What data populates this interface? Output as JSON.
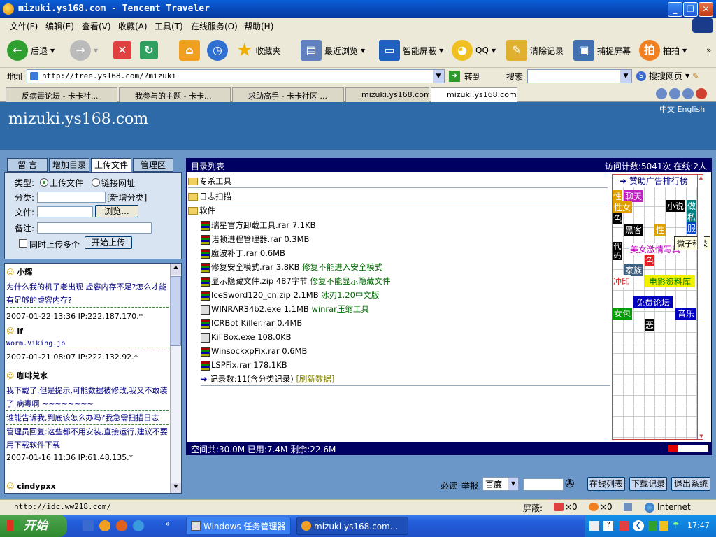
{
  "window": {
    "title": "mizuki.ys168.com - Tencent Traveler"
  },
  "menu": [
    "文件(F)",
    "编辑(E)",
    "查看(V)",
    "收藏(A)",
    "工具(T)",
    "在线服务(O)",
    "帮助(H)"
  ],
  "toolbar": {
    "back": "后退",
    "favorites": "收藏夹",
    "recent": "最近浏览",
    "smart_block": "智能屏蔽",
    "qq": "QQ",
    "clear": "清除记录",
    "capture": "捕捉屏幕",
    "paipai": "拍拍",
    "more": "»"
  },
  "address": {
    "label": "地址",
    "url": "http://free.ys168.com/?mizuki",
    "go": "转到",
    "search_label": "搜索",
    "search_engine": "搜搜网页"
  },
  "tabs": [
    {
      "label": "反病毒论坛 - 卡卡社..."
    },
    {
      "label": "我参与的主题 - 卡卡..."
    },
    {
      "label": "求助高手 - 卡卡社区 ..."
    },
    {
      "label": "mizuki.ys168.com"
    },
    {
      "label": "mizuki.ys168.com"
    }
  ],
  "site": {
    "title": "mizuki.ys168.com",
    "lang": "中文 English"
  },
  "left_tabs": [
    "留 言",
    "增加目录",
    "上传文件",
    "管理区"
  ],
  "upload_form": {
    "type_label": "类型:",
    "opt_upload": "上传文件",
    "opt_link": "链接网址",
    "category_label": "分类:",
    "new_category": "[新增分类]",
    "file_label": "文件:",
    "browse": "浏览...",
    "note_label": "备注:",
    "multi": "同时上传多个",
    "start": "开始上传"
  },
  "messages": [
    {
      "name": "小辉",
      "text": "为什么我的机子老出现 虚容内存不足?怎么才能有足够的虚容内存?",
      "meta": ""
    },
    {
      "name": "",
      "text": "",
      "meta": "2007-01-22 13:36 IP:222.187.170.*"
    },
    {
      "name": "lf",
      "text": "Worm.Viking.jb",
      "meta": "2007-01-21 08:07 IP:222.132.92.*"
    },
    {
      "name": "咖啡兑水",
      "text": "我下载了,但是提示,可能数据被修改,我又不敢装了.病毒啊 ~~~~~~~~",
      "meta": ""
    },
    {
      "name": "",
      "text": "谁能告诉我,到底该怎么办吗?我急需扫描日志",
      "meta": ""
    },
    {
      "name": "",
      "text": "管理员回复:这些都不用安装,直接运行,建议不要用下载软件下载",
      "meta": "2007-01-16 11:36 IP:61.48.135.*"
    },
    {
      "name": "cindypxx",
      "text": "",
      "meta": ""
    }
  ],
  "main": {
    "header": "目录列表",
    "counter": "访问计数:5041次 在线:2人",
    "folders": [
      "专杀工具",
      "日志扫描",
      "软件"
    ],
    "files": [
      {
        "name": "瑞星官方卸载工具.rar 7.1KB",
        "note": ""
      },
      {
        "name": "诺顿进程管理器.rar 0.3MB",
        "note": ""
      },
      {
        "name": "魔波补丁.rar 0.6MB",
        "note": ""
      },
      {
        "name": "修复安全模式.rar 3.8KB",
        "note": "修复不能进入安全模式"
      },
      {
        "name": "显示隐藏文件.zip 487字节",
        "note": "修复不能显示隐藏文件"
      },
      {
        "name": "IceSword120_cn.zip 2.1MB",
        "note": "冰刃1.20中文版"
      },
      {
        "name": "WINRAR34b2.exe 1.1MB",
        "note": "winrar压缩工具"
      },
      {
        "name": "ICRBot Killer.rar 0.4MB",
        "note": ""
      },
      {
        "name": "KillBox.exe 108.0KB",
        "note": ""
      },
      {
        "name": "WinsockxpFix.rar 0.6MB",
        "note": ""
      },
      {
        "name": "LSPFix.rar 178.1KB",
        "note": ""
      }
    ],
    "record": "记录数:11(含分类记录)",
    "refresh": "[刷新数据]",
    "space": "空间共:30.0M 已用:7.4M 剩余:22.6M",
    "used_fraction": 0.247
  },
  "ads": {
    "title": "赞助广告排行榜",
    "tooltip": "微子科技",
    "labels": [
      "性",
      "聊天",
      "性女",
      "小说",
      "做",
      "私",
      "服",
      "色",
      "黑客",
      "性",
      "代码",
      "美女激情写真",
      "色",
      "家族",
      "冲印",
      "电影资料库",
      "免费论坛",
      "女包",
      "音乐",
      "恶"
    ]
  },
  "bottom": {
    "must_read": "必读",
    "report": "举报",
    "engine": "百度",
    "online_list": "在线列表",
    "download_log": "下载记录",
    "logout": "退出系统"
  },
  "status": {
    "url": "http://idc.ww218.com/",
    "block_label": "屏蔽:",
    "block1": "×0",
    "block2": "×0",
    "zone": "Internet"
  },
  "taskbar": {
    "start": "开始",
    "tasks": [
      "Windows 任务管理器",
      "mizuki.ys168.com..."
    ],
    "clock": "17:47",
    "more": "»"
  }
}
